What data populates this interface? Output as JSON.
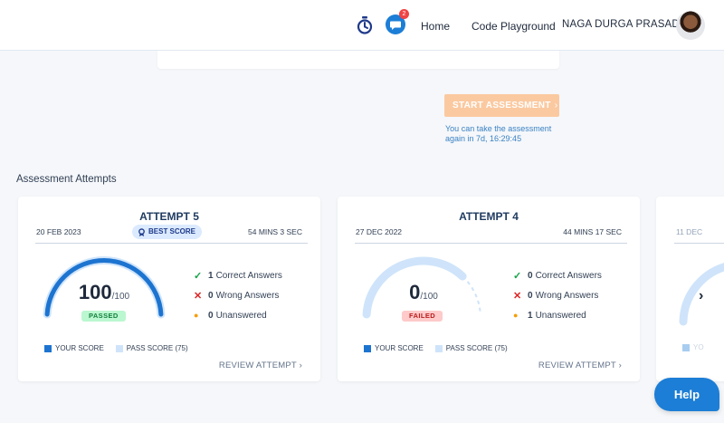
{
  "header": {
    "nav": {
      "home": "Home",
      "code_playground": "Code Playground",
      "user_name": "NAGA DURGA PRASAD"
    },
    "notification_count": "2",
    "accent_color": "#1c7ed6"
  },
  "assessment": {
    "start_label": "START ASSESSMENT",
    "retake_line1": "You can take the assessment",
    "retake_line2": "again in 7d, 16:29:45",
    "section_title": "Assessment Attempts"
  },
  "attempts": [
    {
      "title": "ATTEMPT 5",
      "date": "20 FEB 2023",
      "badge": "BEST SCORE",
      "duration": "54 MINS 3 SEC",
      "score": "100",
      "total": "/100",
      "score_fraction": 1.0,
      "pass_fraction": 0.75,
      "status": "PASSED",
      "correct_count": "1",
      "correct_label": "Correct Answers",
      "wrong_count": "0",
      "wrong_label": "Wrong Answers",
      "unanswered_count": "0",
      "unanswered_label": "Unanswered",
      "legend_your": "YOUR SCORE",
      "legend_pass": "PASS SCORE (75)",
      "review": "REVIEW ATTEMPT"
    },
    {
      "title": "ATTEMPT 4",
      "date": "27 DEC 2022",
      "duration": "44 MINS 17 SEC",
      "score": "0",
      "total": "/100",
      "score_fraction": 0.0,
      "pass_fraction": 0.75,
      "status": "FAILED",
      "correct_count": "0",
      "correct_label": "Correct Answers",
      "wrong_count": "0",
      "wrong_label": "Wrong Answers",
      "unanswered_count": "1",
      "unanswered_label": "Unanswered",
      "legend_your": "YOUR SCORE",
      "legend_pass": "PASS SCORE (75)",
      "review": "REVIEW ATTEMPT"
    },
    {
      "date": "11 DEC",
      "legend_your": "YO"
    }
  ],
  "help_label": "Help"
}
